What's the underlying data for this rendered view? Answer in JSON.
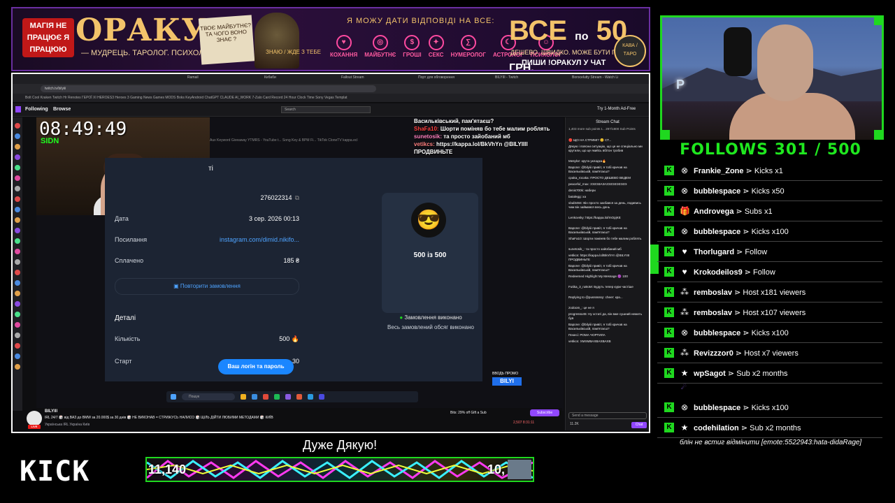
{
  "banner": {
    "badge": "МАГІЯ НЕ ПРАЦЮЄ Я ПРАЦЮЮ",
    "title": "ОРАКУЛ",
    "subtitle": "— МУДРЕЦЬ. ТАРОЛОГ. ПСИХОЛОГ. —",
    "note": "ТВОЄ МАЙБУТНЄ? ТА ЧОГО ВОНО ЗНАЄ ?",
    "crystal": "ЗНАЮ / ЖДЕ З ТЕБЕ",
    "slogan": "Я МОЖУ ДАТИ ВІДПОВІДІ НА ВСЕ:",
    "categories": [
      "КОХАННЯ",
      "МАЙБУТНЄ",
      "ГРОШІ",
      "СЕКС",
      "НУМЕРОЛОГ",
      "АСТРОЛОГ",
      "ПСИХОЛОГ"
    ],
    "price_prefix": "ВСЕ",
    "price_small": "по",
    "price_value": "50",
    "price_unit": "ГРН.",
    "price_line2": "ДЕШЕВО. ШВИДКО. МОЖЕ БУТИ ПРАВДА.",
    "price_line3": "ПИШИ !ОРАКУЛ У ЧАТ",
    "coin": "КАВА / ТАРО"
  },
  "browser": {
    "url": "twitch.tv/bilyiii",
    "bookmarks": "Bolt   Cool   Kraken   Twitch   Hr   Renotes   ГЕРОЇ XI   HEROES3   Heroes 3   Gaming News   Games   MODS   Boks   KeyAndroid   ChatGPT   CLAUDE   AI_WORK   7-Zalo Card Record   24 Hour Clock Time   Sony Vegas Templat",
    "tabs": [
      "Ramail",
      "Кебаби",
      "Fallout Stream",
      "Порт для обговорення",
      "BILYIII - Twitch",
      "Borocelutty Stream - Watch Li"
    ]
  },
  "twitch_nav": {
    "following": "Following",
    "browse": "Browse",
    "search_placeholder": "Search",
    "try_label": "Try 1-Month Ad-Free"
  },
  "stream": {
    "clock": "08:49:49",
    "tag": "SIDN",
    "ghost_tabs": "Aux   Keyword Giveaway   YTMRS - YouTube t...   Song Key & BPM Fi...   TikTok   CloneTV   kappa.ecl",
    "overlay_chat": [
      {
        "name": "",
        "text": "Васильківський, пам'ятаєш?"
      },
      {
        "name": "ShaFa10:",
        "text": "Шорти поміняв бо тебе малим роблять"
      },
      {
        "name": "sunetosik:",
        "text": "та просто зайобаний мб"
      },
      {
        "name": "vetikcs:",
        "text": "https://kappa.lol/BkVhYn @BILYIIII ПРОДВИНЬТЕ"
      }
    ],
    "order_header": "ті",
    "order_id": "276022314",
    "rows": [
      {
        "label": "Дата",
        "value": "3 сер. 2026 00:13"
      },
      {
        "label": "Посилання",
        "value": "instagram.com/dimid.nikifo..."
      },
      {
        "label": "Сплачено",
        "value": "185 ₴"
      }
    ],
    "repeat_button": "Повторити замовлення",
    "details_title": "Деталі",
    "detail_rows": [
      {
        "label": "Кількість",
        "value": "500 🔥"
      },
      {
        "label": "Старт",
        "value": "30"
      }
    ],
    "progress": "500 із 500",
    "status_title": "Замовлення виконано",
    "status_text": "Весь замовлений обсяг виконано",
    "login_button": "Ваш логін та пароль",
    "taskbar_search": "Пошук",
    "promo_line": "ВВОДЬ ПРОМО",
    "promo_code": "BILYI"
  },
  "infobar": {
    "name": "BILYIII",
    "live": "LIVE",
    "status": "IRL 24/7 🎲 від ВАЗ до BMW за 20.000$ за 30 днів 🎲 НЕ ВИКОНАВ = СТРИЖУСЬ НАЛИСО 🎲 ЩІЛЬ ДІЙТИ ЛЮБИМИ МЕТОДАМИ 🎲 КИЇВ",
    "tags": "Українська   IRL   Україна   Київ",
    "bits": "Bits: 29% off      Gift a Sub",
    "subscribe": "Subscribe",
    "viewers": "2,507    8:31:11"
  },
  "twitch_chat": {
    "header": "Stream Chat",
    "pinned": "1,403 more sub points t... 297/1800 Sub Points",
    "lines": [
      "🔴 ЩО НА СТРИМІ? 😊 СТ...",
      "Дякую і поясни ситуацію, що це не спеціально ми крутили, що це якийсь вбітон тробив",
      "Mesylor: крута укладка🔥",
      "Bapone: @bilyiii привіт, я тобі кричав на Васильківській, пам'ятаєш?",
      "cpaka_rocaka: ПРОСТО ДЕШЕВО ВЕДЕМ",
      "peaceful_max: 3Э3Э3А3А3Э3Э3Э3Э3Э",
      "denis700k: набери",
      "batalegg: xa",
      "vlad3484: Він просто заєбався за день, подивись чим він займався весь день",
      "Lenkovsky: https://kappa.lol/mOpjKE",
      "Bapone: @bilyiii привіт, я тобі кричав на Васильківській, пам'ятаєш?",
      "ShaFa10: Шорти поміняв бо тебе малим роблять",
      "sunetosik_: та просто зайобаний мб",
      "vetikcs: https://kappa.lol/BkVhYn @BILYIIII ПРОДВИНЬТЕ",
      "Bapone: @bilyiii привіт, я тобі кричав на Васильківській, пам'ятаєш?",
      "Redeemed Highlight My Message 🟣 100",
      "Futika_3_ruBoM: Будуть тепер кури частіше",
      "Replying to @pussssssy: cheer: кра...",
      "zodoom_: це не я",
      "progresso45: Ну хстаті да, він вже сушний нежить був",
      "Bapone: @bilyiii привіт, я тобі кричав на Васильківській, пам'ятаєш?",
      "Пекесі: РОМА ЧОРТИЛА",
      "vetikcs: ХМХМВАХВАХВАХВ"
    ],
    "send_placeholder": "Send a message",
    "points": "11.2K",
    "chat_button": "Chat"
  },
  "follow_goal": "FOLLOWS 301 / 500",
  "events": [
    {
      "icon": "kick-icon",
      "glyph": "⊗",
      "user": "Frankie_Zone",
      "action": "Kicks x1"
    },
    {
      "icon": "kick-icon",
      "glyph": "⊗",
      "user": "bubblespace",
      "action": "Kicks x50"
    },
    {
      "icon": "gift-icon",
      "glyph": "🎁",
      "user": "Androvega",
      "action": "Subs x1"
    },
    {
      "icon": "kick-icon",
      "glyph": "⊗",
      "user": "bubblespace",
      "action": "Kicks x100"
    },
    {
      "icon": "heart-icon",
      "glyph": "♥",
      "user": "Thorlugard",
      "action": "Follow"
    },
    {
      "icon": "heart-icon",
      "glyph": "♥",
      "user": "Krokodeilos9",
      "action": "Follow"
    },
    {
      "icon": "host-icon",
      "glyph": "⁂",
      "user": "remboslav",
      "action": "Host x181 viewers"
    },
    {
      "icon": "host-icon",
      "glyph": "⁂",
      "user": "remboslav",
      "action": "Host x107 viewers"
    },
    {
      "icon": "kick-icon",
      "glyph": "⊗",
      "user": "bubblespace",
      "action": "Kicks x100"
    },
    {
      "icon": "host-icon",
      "glyph": "⁂",
      "user": "Revizzzor0",
      "action": "Host x7 viewers"
    },
    {
      "icon": "star-icon",
      "glyph": "★",
      "user": "wpSagot",
      "action": "Sub x2 months"
    },
    {
      "icon": "kick-icon",
      "glyph": "⊗",
      "user": "bubblespace",
      "action": "Kicks x100"
    },
    {
      "icon": "star-icon",
      "glyph": "★",
      "user": "codehilation",
      "action": "Sub x2 months"
    }
  ],
  "event_message": "блін не встиг відмінити [emote:5522943:hata-didaRage]",
  "event_sep": "⋗",
  "kick_logo": "KICK",
  "thanks": "Дуже Дякую!",
  "donation_left": "11,140",
  "donation_right": "10,",
  "colors": {
    "kick_green": "#1fd81f",
    "twitch_purple": "#9147ff",
    "link_blue": "#4ea3ff"
  }
}
